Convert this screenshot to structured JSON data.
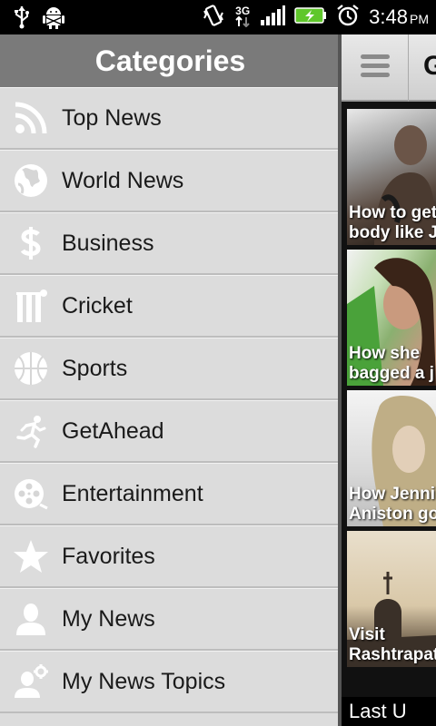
{
  "status_bar": {
    "network": "3G",
    "time": "3:48",
    "ampm": "PM",
    "icons": [
      "usb-icon",
      "android-debug-icon",
      "vibrate-icon",
      "3g-icon",
      "signal-icon",
      "battery-charging-icon",
      "alarm-icon"
    ]
  },
  "drawer": {
    "title": "Categories",
    "items": [
      {
        "label": "Top News",
        "icon": "rss-icon"
      },
      {
        "label": "World News",
        "icon": "globe-icon"
      },
      {
        "label": "Business",
        "icon": "dollar-icon"
      },
      {
        "label": "Cricket",
        "icon": "cricket-stumps-icon"
      },
      {
        "label": "Sports",
        "icon": "basketball-icon"
      },
      {
        "label": "GetAhead",
        "icon": "runner-icon"
      },
      {
        "label": "Entertainment",
        "icon": "film-reel-icon"
      },
      {
        "label": "Favorites",
        "icon": "star-icon"
      },
      {
        "label": "My News",
        "icon": "person-icon"
      },
      {
        "label": "My News Topics",
        "icon": "person-gear-icon"
      }
    ]
  },
  "main": {
    "title": "G",
    "cards": [
      {
        "caption": "How to get\nbody like J"
      },
      {
        "caption": "How she\nbagged a j"
      },
      {
        "caption": "How Jenni\nAniston go"
      },
      {
        "caption": "Visit\nRashtrapat"
      }
    ],
    "footer": "Last U"
  },
  "colors": {
    "drawer_bg": "#dcdcdc",
    "drawer_header": "#7a7a7a",
    "icon_white": "#ffffff"
  }
}
